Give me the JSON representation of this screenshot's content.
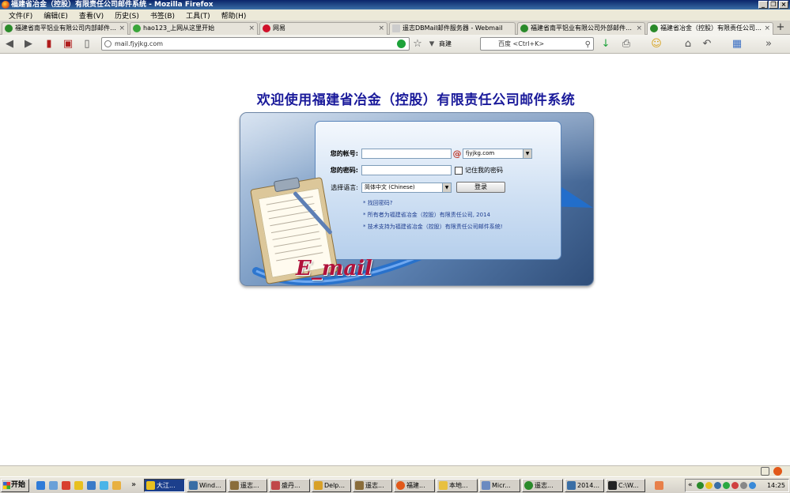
{
  "window": {
    "title": "福建省冶金（控股）有限责任公司邮件系统 - Mozilla Firefox",
    "buttons": [
      "_",
      "❐",
      "×"
    ]
  },
  "menu": [
    "文件(F)",
    "编辑(E)",
    "查看(V)",
    "历史(S)",
    "书签(B)",
    "工具(T)",
    "帮助(H)"
  ],
  "tabs": [
    {
      "label": "福建省南平铝业有限公司内部邮件…",
      "color": "#2a8a2a",
      "active": false
    },
    {
      "label": "hao123_上网从这里开始",
      "color": "#3aa53a",
      "active": false
    },
    {
      "label": "网易",
      "color": "#d0102a",
      "active": false
    },
    {
      "label": "遥志DBMail邮件服务器 - Webmail",
      "color": "#cccccc",
      "active": false
    },
    {
      "label": "福建省南平铝业有限公司外部邮件…",
      "color": "#2a8a2a",
      "active": false
    },
    {
      "label": "福建省冶金（控股）有限责任公司…",
      "color": "#2a8a2a",
      "active": true
    }
  ],
  "tab_close": "×",
  "new_tab": "+",
  "nav": {
    "url": "mail.fjyjkg.com",
    "engine_label": "商建",
    "search_placeholder": "百度 <Ctrl+K>"
  },
  "page": {
    "title": "欢迎使用福建省冶金（控股）有限责任公司邮件系统",
    "account_label": "您的帐号:",
    "at_sign": "@",
    "domain": "fjyjkg.com",
    "password_label": "您的密码:",
    "remember_label": "记住我的密码",
    "language_label": "选择语言:",
    "language_value": "简体中文 (Chinese)",
    "login_button": "登录",
    "links": [
      "* 找回密码?",
      "* 所有者为福建省冶金（控股）有限责任公司, 2014",
      "* 技术支持为福建省冶金（控股）有限责任公司邮件系统!"
    ],
    "logo_text": "E_mail"
  },
  "taskbar": {
    "start_label": "开始",
    "tasks": [
      {
        "label": "大江...",
        "active": true
      },
      {
        "label": "Wind...",
        "active": false
      },
      {
        "label": "遥志...",
        "active": false
      },
      {
        "label": "盛丹...",
        "active": false
      },
      {
        "label": "Delp...",
        "active": false
      },
      {
        "label": "遥志...",
        "active": false
      },
      {
        "label": "福建...",
        "active": false
      },
      {
        "label": "本地...",
        "active": false
      },
      {
        "label": "Micr...",
        "active": false
      },
      {
        "label": "遥志...",
        "active": false
      },
      {
        "label": "2014...",
        "active": false
      },
      {
        "label": "C:\\W...",
        "active": false
      }
    ],
    "clock": "14:25"
  }
}
